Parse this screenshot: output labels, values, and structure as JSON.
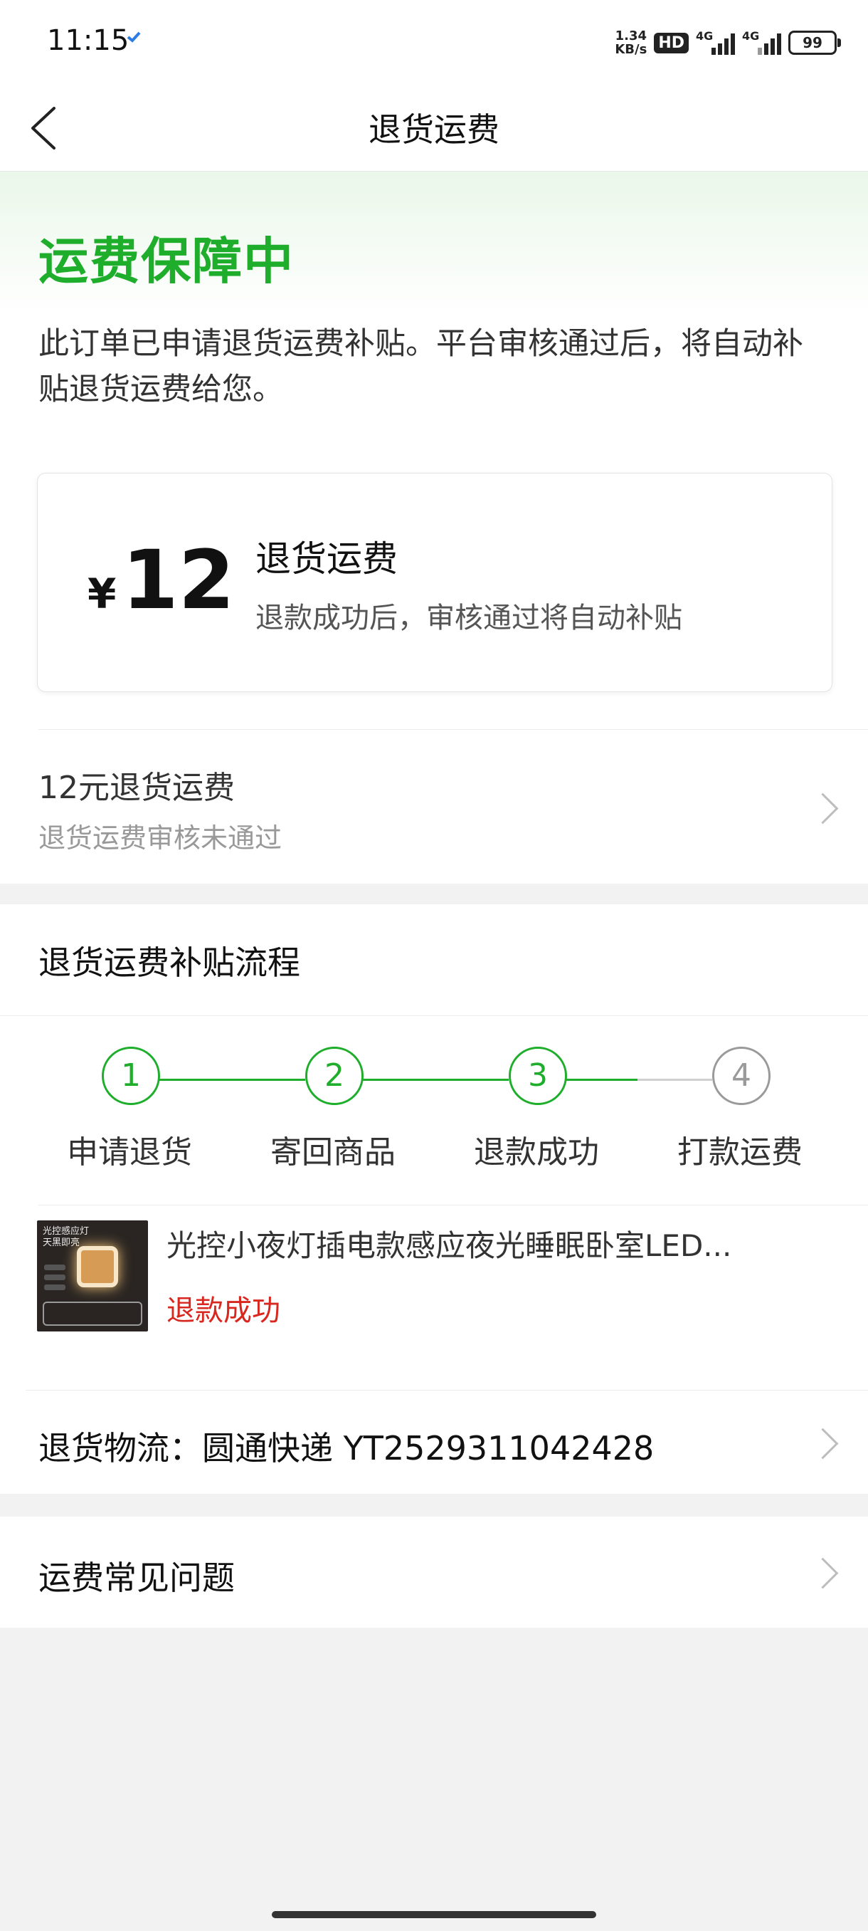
{
  "status_bar": {
    "time": "11:15",
    "speed_value": "1.34",
    "speed_unit": "KB/s",
    "hd_label": "HD",
    "network1": "4G",
    "network2": "4G",
    "battery": "99"
  },
  "header": {
    "title": "退货运费"
  },
  "protection": {
    "title": "运费保障中",
    "description": "此订单已申请退货运费补贴。平台审核通过后，将自动补贴退货运费给您。",
    "fee_card": {
      "currency": "¥",
      "amount": "12",
      "title": "退货运费",
      "subtitle": "退款成功后，审核通过将自动补贴"
    },
    "subsidy": {
      "title": "12元退货运费",
      "status": "退货运费审核未通过"
    }
  },
  "process": {
    "title": "退货运费补贴流程",
    "steps": [
      {
        "number": "1",
        "label": "申请退货"
      },
      {
        "number": "2",
        "label": "寄回商品"
      },
      {
        "number": "3",
        "label": "退款成功"
      },
      {
        "number": "4",
        "label": "打款运费"
      }
    ],
    "product": {
      "image_text": "光控感应灯\n天黑即亮",
      "name": "光控小夜灯插电款感应夜光睡眠卧室LED...",
      "status": "退款成功"
    },
    "logistics": "退货物流：圆通快递 YT2529311042428"
  },
  "faq": {
    "label": "运费常见问题"
  },
  "colors": {
    "accent_green": "#1fae2c",
    "refund_red": "#d7271f",
    "inactive_gray": "#9a9a9a"
  }
}
